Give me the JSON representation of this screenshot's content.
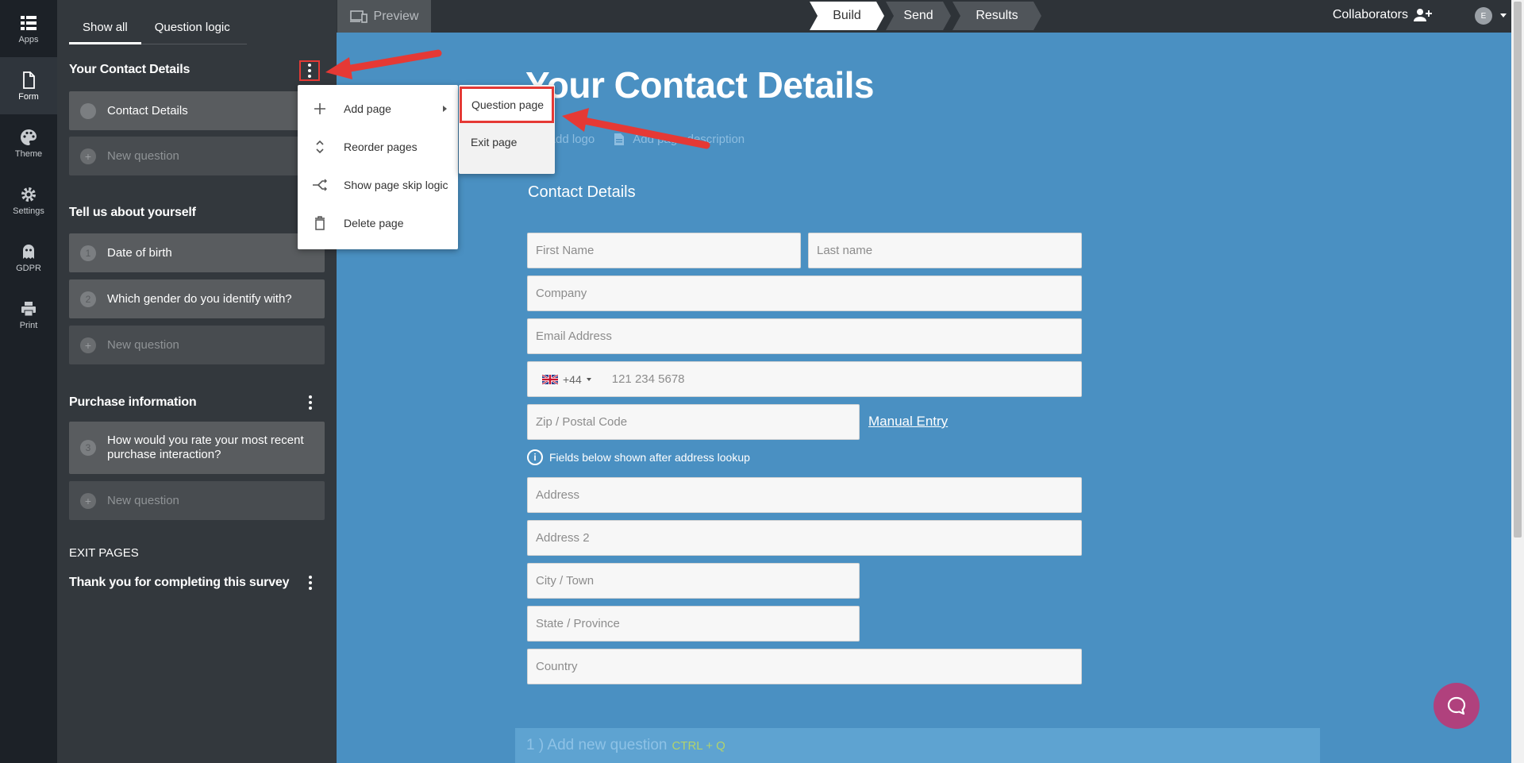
{
  "rail": [
    {
      "label": "Apps",
      "icon": "apps-grid-icon"
    },
    {
      "label": "Form",
      "icon": "document-icon"
    },
    {
      "label": "Theme",
      "icon": "palette-icon"
    },
    {
      "label": "Settings",
      "icon": "gear-icon"
    },
    {
      "label": "GDPR",
      "icon": "ghost-icon"
    },
    {
      "label": "Print",
      "icon": "printer-icon"
    }
  ],
  "sidebar": {
    "tabs": [
      "Show all",
      "Question logic"
    ],
    "sections": [
      {
        "title": "Your Contact Details",
        "items": [
          {
            "num": "",
            "label": "Contact Details"
          },
          {
            "num": "+",
            "label": "New question"
          }
        ]
      },
      {
        "title": "Tell us about yourself",
        "items": [
          {
            "num": "1",
            "label": "Date of birth"
          },
          {
            "num": "2",
            "label": "Which gender do you identify with?"
          },
          {
            "num": "+",
            "label": "New question"
          }
        ]
      },
      {
        "title": "Purchase information",
        "items": [
          {
            "num": "3",
            "label": "How would you rate your most recent purchase interaction?"
          },
          {
            "num": "+",
            "label": "New question"
          }
        ]
      }
    ],
    "exit_label": "EXIT PAGES",
    "exit_page_title": "Thank you for completing this survey"
  },
  "topbar": {
    "preview": "Preview",
    "steps": [
      "Build",
      "Send",
      "Results"
    ],
    "collaborators": "Collaborators",
    "avatar_initial": "E"
  },
  "menu": {
    "items": [
      "Add page",
      "Reorder pages",
      "Show page skip logic",
      "Delete page"
    ],
    "submenu": [
      "Question page",
      "Exit page"
    ]
  },
  "form": {
    "title": "Your Contact Details",
    "add_logo": "Add logo",
    "add_description": "Add page description",
    "section": "Contact Details",
    "fields": {
      "first_name": "First Name",
      "last_name": "Last name",
      "company": "Company",
      "email": "Email Address",
      "dial_code": "+44",
      "phone": "121 234 5678",
      "zip": "Zip / Postal Code",
      "address": "Address",
      "address2": "Address 2",
      "city": "City / Town",
      "state": "State / Province",
      "country": "Country"
    },
    "manual_entry": "Manual Entry",
    "lookup_note": "Fields below shown after address lookup",
    "add_question": "1 )  Add new question",
    "add_question_shortcut": "CTRL + Q"
  },
  "colors": {
    "canvas": "#4a90c2",
    "sidebar": "#33383d",
    "rail": "#1c2127",
    "annotation": "#e53935",
    "chat": "#b0417d"
  }
}
